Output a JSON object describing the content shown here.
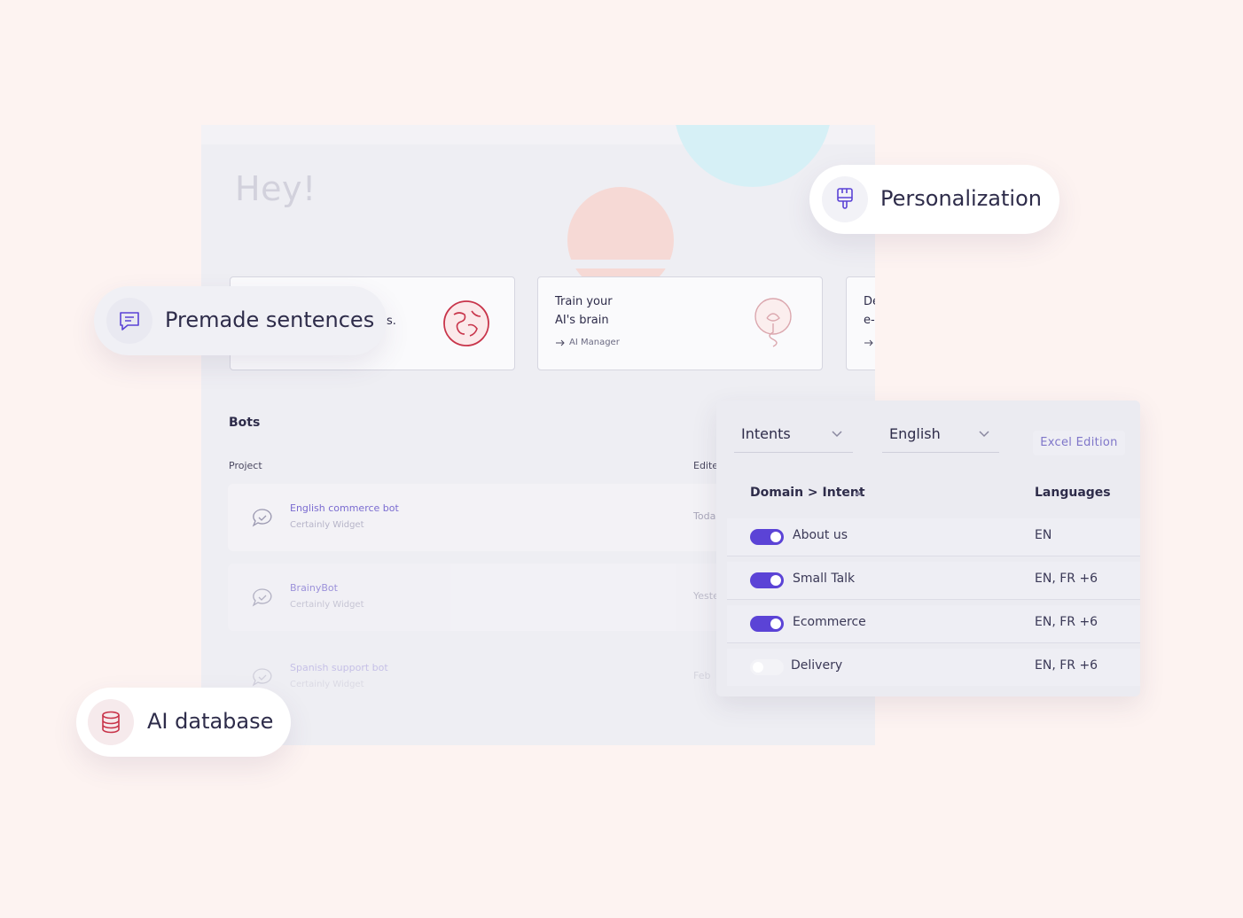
{
  "colors": {
    "page_bg": "#fdf3f1",
    "accent_purple": "#5b43d6",
    "accent_red": "#c8344a",
    "link_purple": "#7a6bd0"
  },
  "dashboard": {
    "greeting": "Hey!",
    "cards": [
      {
        "snippet": "s.",
        "icon": "globe-icon"
      },
      {
        "title_line1": "Train your",
        "title_line2": "AI's brain",
        "link": "AI Manager",
        "icon": "lightbulb-icon"
      },
      {
        "title_line1": "De",
        "title_line2": "e-",
        "icon": "arrow-right-icon"
      }
    ],
    "bots": {
      "title": "Bots",
      "project_header": "Project",
      "edited_header": "Edite",
      "rows": [
        {
          "name": "English commerce bot",
          "subtitle": "Certainly Widget",
          "date": "Toda"
        },
        {
          "name": "BrainyBot",
          "subtitle": "Certainly Widget",
          "date": "Yeste"
        },
        {
          "name": "Spanish support bot",
          "subtitle": "Certainly Widget",
          "date": "Feb"
        }
      ]
    }
  },
  "intents_panel": {
    "type_select": "Intents",
    "language_select": "English",
    "excel_button": "Excel Edition",
    "header_domain": "Domain > Intent",
    "header_languages": "Languages",
    "rows": [
      {
        "name": "About us",
        "languages": "EN",
        "enabled": true
      },
      {
        "name": "Small Talk",
        "languages": "EN, FR +6",
        "enabled": true
      },
      {
        "name": "Ecommerce",
        "languages": "EN, FR +6",
        "enabled": true
      },
      {
        "name": "Delivery",
        "languages": "EN, FR +6",
        "enabled": false
      }
    ]
  },
  "pills": {
    "premade": {
      "label": "Premade sentences",
      "icon": "chat-icon"
    },
    "personalization": {
      "label": "Personalization",
      "icon": "paintbrush-icon"
    },
    "ai_database": {
      "label": "AI database",
      "icon": "database-icon"
    }
  }
}
